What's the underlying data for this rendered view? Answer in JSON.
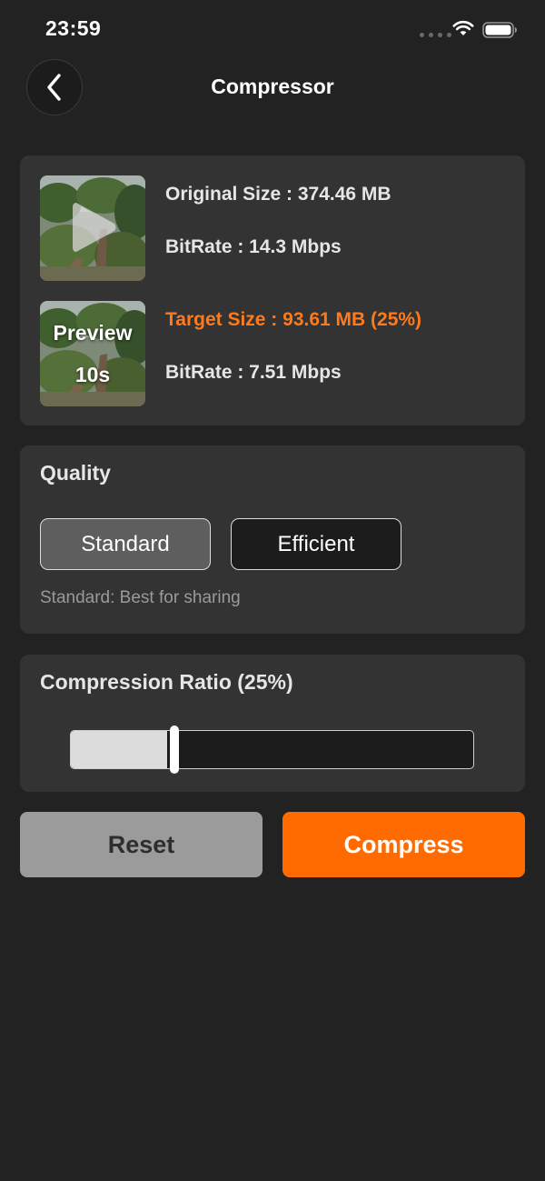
{
  "status_bar": {
    "time": "23:59",
    "icons": [
      "signal-dots-icon",
      "wifi-icon",
      "battery-icon"
    ]
  },
  "nav": {
    "back_icon": "chevron-left-icon",
    "title": "Compressor"
  },
  "video_info": {
    "original_size": "Original Size : 374.46 MB",
    "original_bitrate": "BitRate : 14.3 Mbps",
    "target_size": "Target Size : 93.61 MB (25%)",
    "target_bitrate": "BitRate : 7.51 Mbps",
    "preview_label": "Preview",
    "preview_duration": "10s",
    "play_icon": "play-icon"
  },
  "quality": {
    "title": "Quality",
    "options": [
      "Standard",
      "Efficient"
    ],
    "selected": "Standard",
    "description": "Standard: Best for sharing"
  },
  "compression": {
    "title": "Compression Ratio (25%)",
    "ratio": 0.25
  },
  "actions": {
    "reset_label": "Reset",
    "compress_label": "Compress"
  },
  "colors": {
    "background": "#222222",
    "card": "#333333",
    "accent": "#ff6b00",
    "target_text": "#ff7a1a",
    "reset_button": "#9b9b9b"
  }
}
